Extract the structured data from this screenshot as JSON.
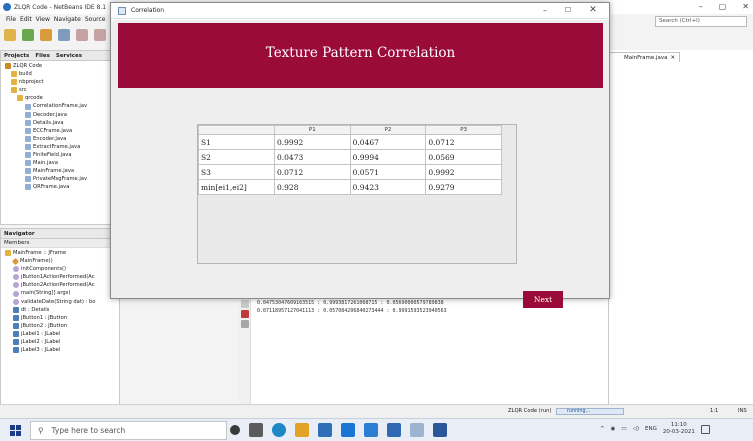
{
  "ide": {
    "window_title": "ZLQR Code - NetBeans IDE 8.1",
    "menu": [
      "File",
      "Edit",
      "View",
      "Navigate",
      "Source",
      "R"
    ],
    "search_placeholder": "Search (Ctrl+I)",
    "projects_panel": {
      "tabs": [
        "Projects",
        "Files",
        "Services"
      ],
      "tree": [
        "ZLQR Code",
        "build",
        "nbproject",
        "src",
        "qrcode",
        "CorrelationFrame.jav",
        "Decoder.java",
        "Details.java",
        "ECCFrame.java",
        "Encoder.java",
        "ExtractFrame.java",
        "FiniteField.java",
        "Main.java",
        "MainFrame.java",
        "PrivateMsgFrame.jav",
        "QRFrame.java"
      ]
    },
    "navigator": {
      "tab": "Navigator",
      "subheader": "Members",
      "items": [
        "MainFrame :: JFrame",
        "MainFrame()",
        "initComponents()",
        "jButton1ActionPerformed(Ac",
        "jButton2ActionPerformed(Ac",
        "main(String[] args)",
        "validateDate(String dat) : bo",
        "dt : Details",
        "jButton1 : JButton",
        "jButton2 : JButton",
        "jLabel1 : JLabel",
        "jLabel2 : JLabel",
        "jLabel3 : JLabel"
      ]
    },
    "editor_tab": "MainFrame.java",
    "output_lines": [
      "0.04753047609163515 : 0.9993817261068715 : 0.05690000579789838",
      "0.07118957127041113 : 0.057084206840273444 : 0.9991593523940563"
    ],
    "status": {
      "project": "ZLQR Code (run)",
      "progress": "running...",
      "position": "1:1",
      "mode": "INS"
    }
  },
  "dialog": {
    "title": "Correlation",
    "header": "Texture Pattern Correlation",
    "next_label": "Next",
    "colors": {
      "header": "#9b0b3a",
      "button": "#9b0b3a"
    }
  },
  "table": {
    "columns": [
      "",
      "P1",
      "P2",
      "P3"
    ],
    "rows": [
      {
        "label": "S1",
        "values": [
          "0.9992",
          "0.0467",
          "0.0712"
        ]
      },
      {
        "label": "S2",
        "values": [
          "0.0473",
          "0.9994",
          "0.0569"
        ]
      },
      {
        "label": "S3",
        "values": [
          "0.0712",
          "0.0571",
          "0.9992"
        ]
      },
      {
        "label": "min[ei1,ei2]",
        "values": [
          "0.928",
          "0.9423",
          "0.9279"
        ]
      }
    ]
  },
  "taskbar": {
    "search_placeholder": "Type here to search",
    "language": "ENG",
    "time": "11:10",
    "date": "20-03-2021"
  }
}
